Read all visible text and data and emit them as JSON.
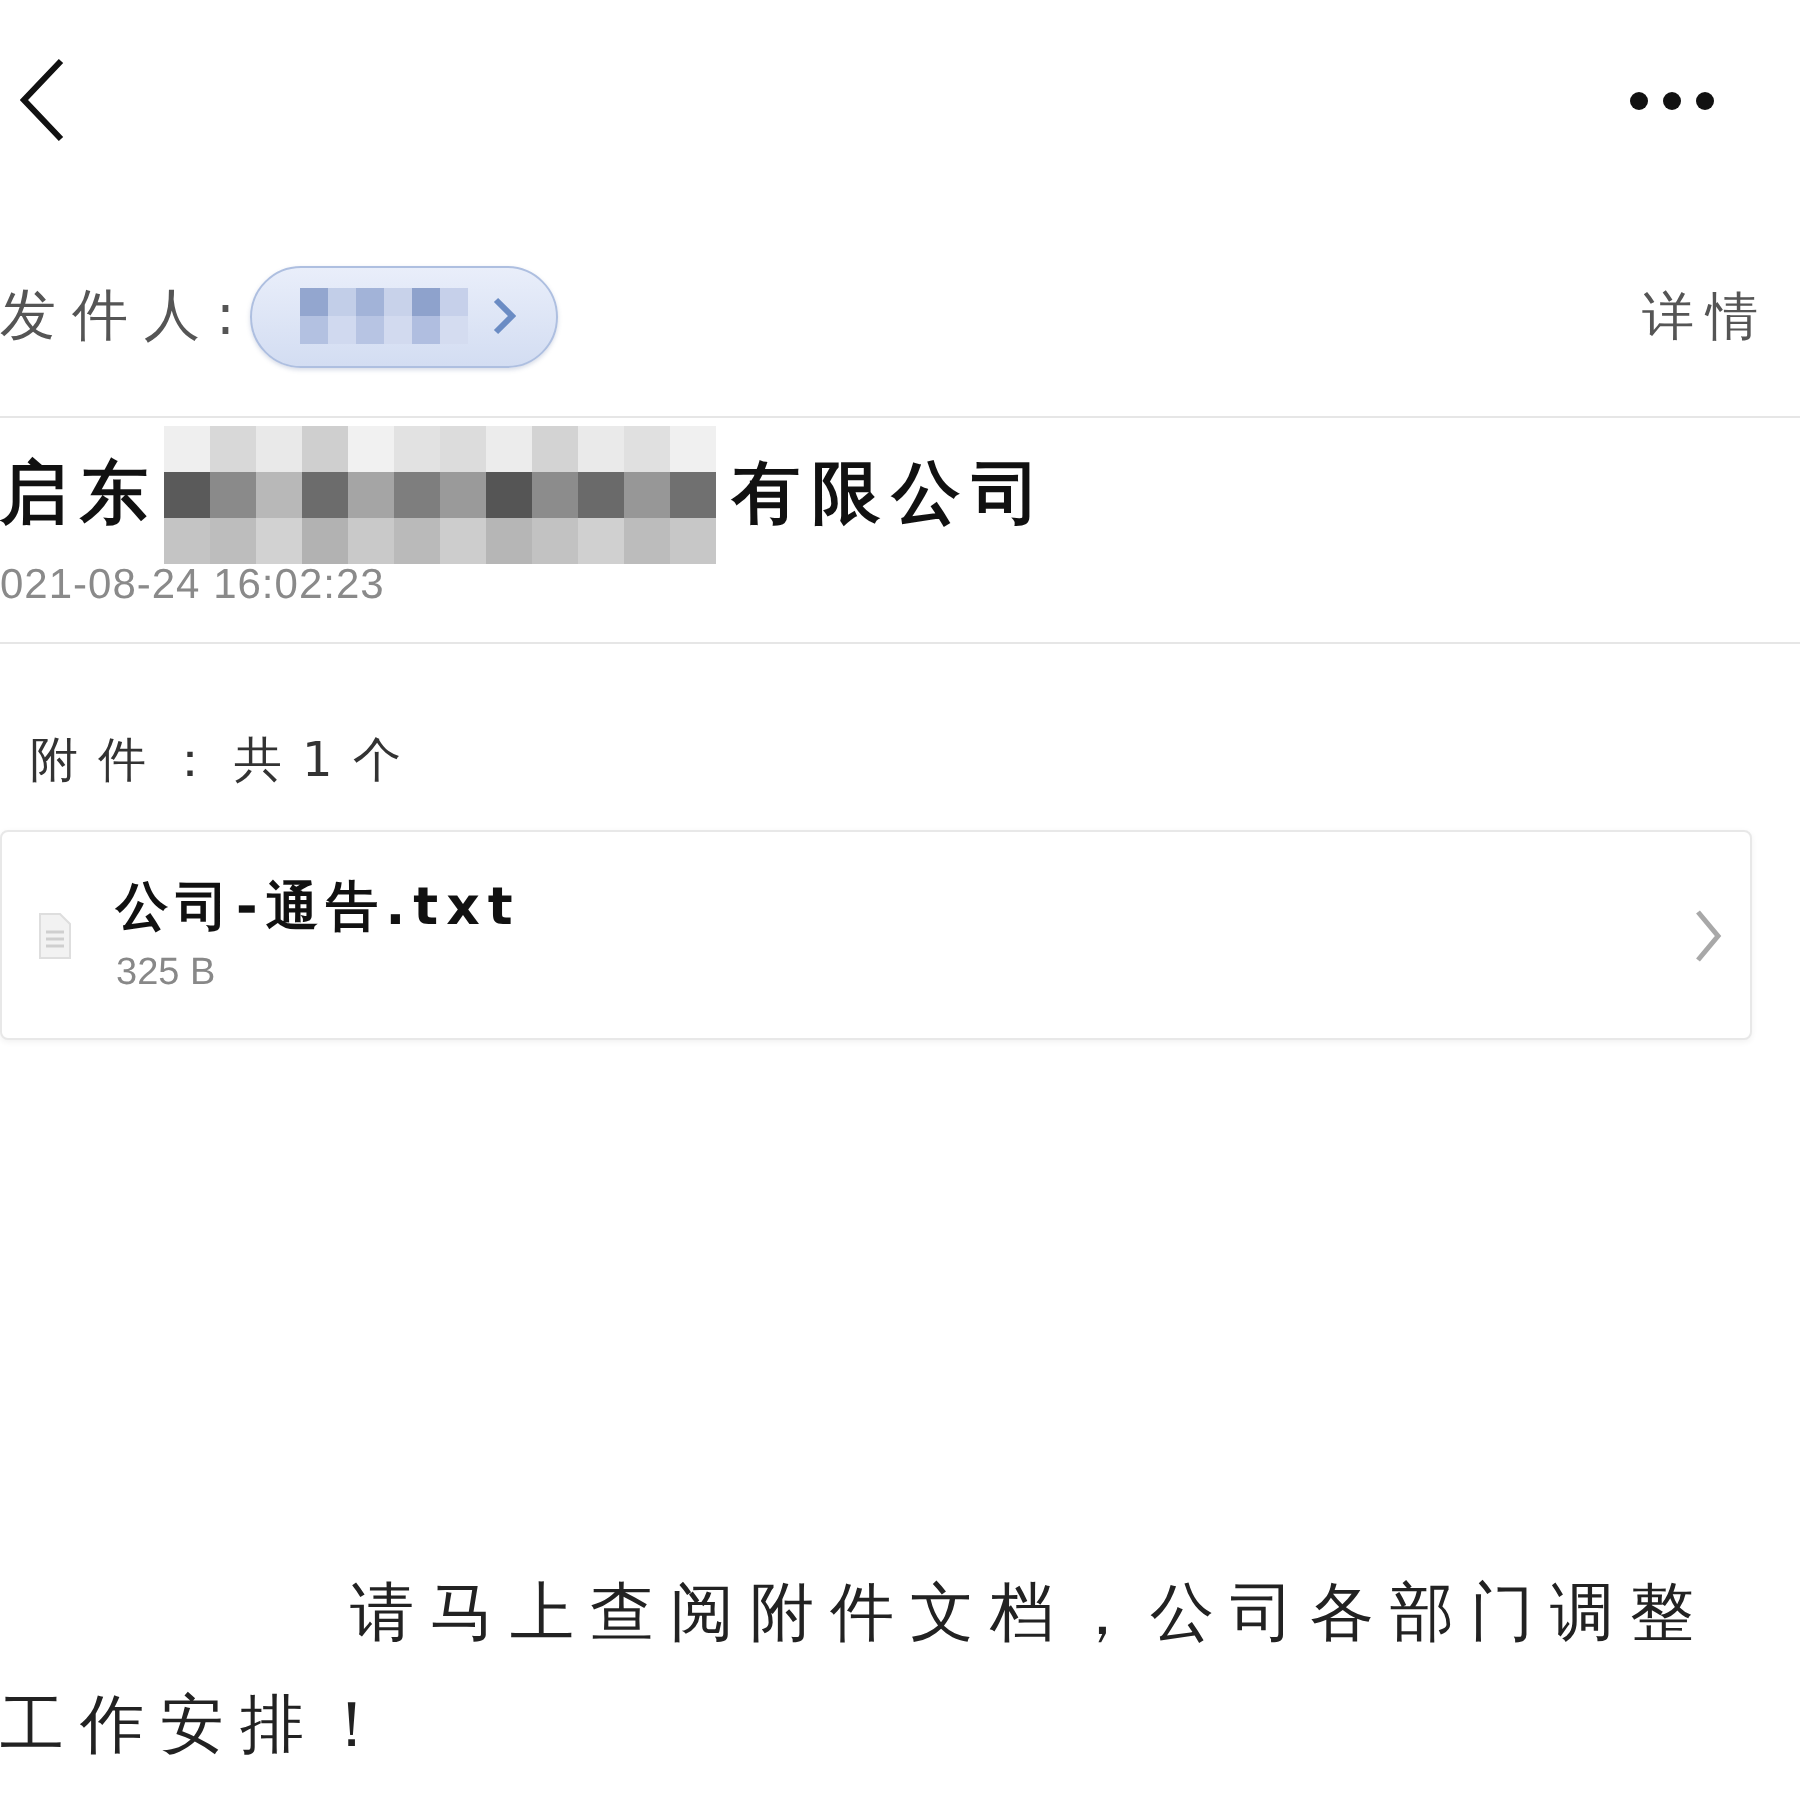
{
  "sender": {
    "label": "发件人:",
    "name": {
      "kind": "redacted"
    },
    "details_link": "详情"
  },
  "subject": {
    "segments": [
      {
        "kind": "text",
        "text": "启东"
      },
      {
        "kind": "redacted"
      },
      {
        "kind": "text",
        "text": "有限公司"
      }
    ]
  },
  "date": "021-08-24 16:02:23",
  "attachments": {
    "summary": "附件：共1个",
    "files": [
      {
        "name": "公司-通告.txt",
        "size": "325 B"
      }
    ]
  },
  "body": {
    "text": "请马上查阅附件文档，公司各部门调整工作安排！"
  }
}
